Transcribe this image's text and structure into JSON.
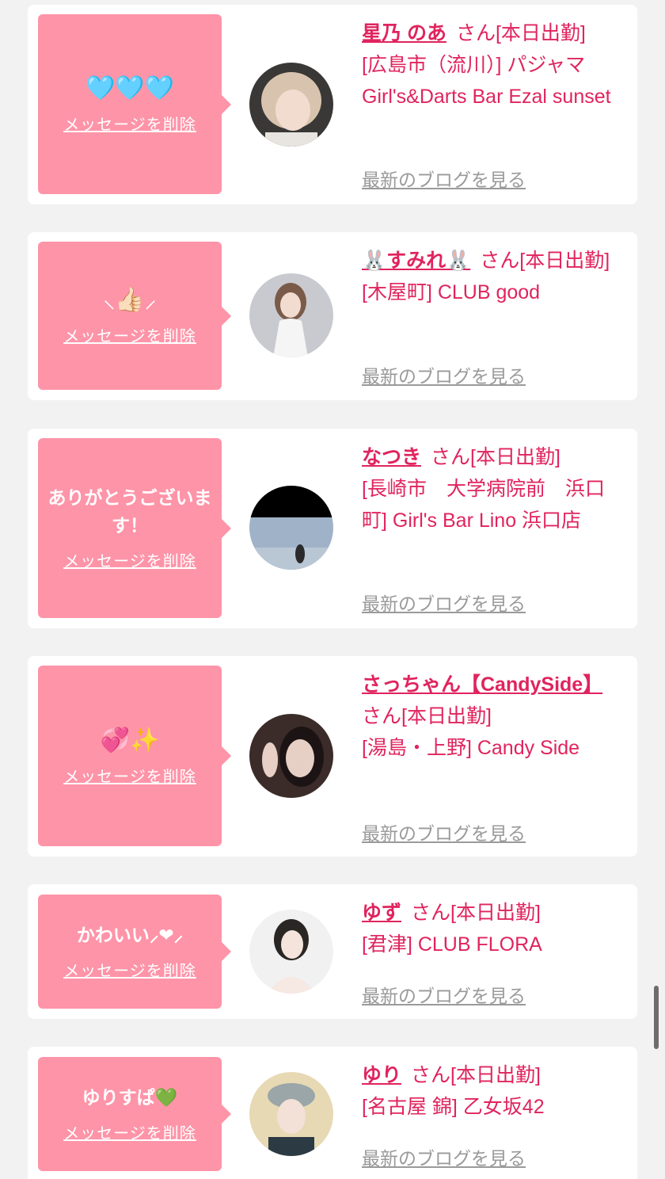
{
  "delete_label": "メッセージを削除",
  "blog_label": "最新のブログを見る",
  "colors": {
    "accent": "#e0245e",
    "bubble": "#fe94a8",
    "muted": "#9a9a9a"
  },
  "cards": [
    {
      "message": "🩵🩵🩵",
      "name": "星乃 のあ",
      "suffix": "さん[本日出勤]",
      "shop": "[広島市（流川）] パジャマGirl's&Darts Bar Ezal sunset"
    },
    {
      "message": "⸜👍🏻⸝‍",
      "name": "🐰すみれ🐰",
      "suffix": "さん[本日出勤]",
      "shop": "[木屋町] CLUB good"
    },
    {
      "message": "ありがとうございます！",
      "name": "なつき",
      "suffix": "さん[本日出勤]",
      "shop": "[長崎市　大学病院前　浜口町] Girl's Bar Lino 浜口店"
    },
    {
      "message": "💞✨",
      "name": "さっちゃん【CandySide】",
      "suffix": "さん[本日出勤]",
      "shop": "[湯島・上野] Candy Side"
    },
    {
      "message": "かわいい⸝❤︎⸝",
      "name": "ゆず",
      "suffix": "さん[本日出勤]",
      "shop": "[君津] CLUB FLORA"
    },
    {
      "message": "ゆりすぱ💚",
      "name": "ゆり",
      "suffix": "さん[本日出勤]",
      "shop": "[名古屋 錦] 乙女坂42"
    }
  ]
}
